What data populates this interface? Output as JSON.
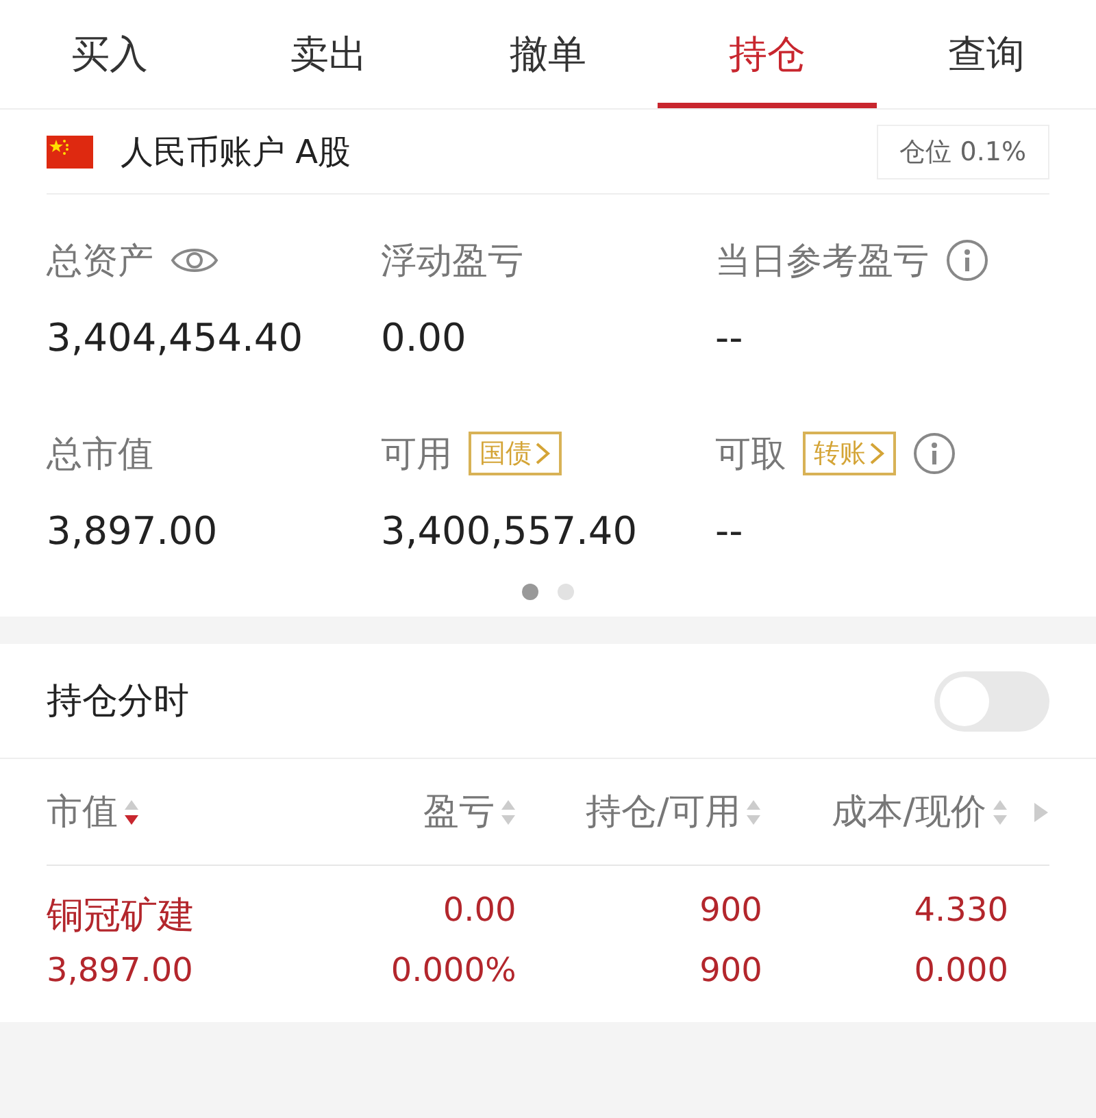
{
  "tabs": [
    {
      "label": "买入",
      "selected": false
    },
    {
      "label": "卖出",
      "selected": false
    },
    {
      "label": "撤单",
      "selected": false
    },
    {
      "label": "持仓",
      "selected": true
    },
    {
      "label": "查询",
      "selected": false
    }
  ],
  "account": {
    "name": "人民币账户 A股",
    "position": "仓位 0.1%"
  },
  "stats": [
    {
      "label": "总资产",
      "value": "3,404,454.40",
      "kind": "hidable"
    },
    {
      "label": "浮动盈亏",
      "value": "0.00",
      "kind": "plain"
    },
    {
      "label": "当日参考盈亏",
      "value": "--",
      "kind": "info"
    },
    {
      "label": "总市值",
      "value": "3,897.00",
      "kind": "plain"
    },
    {
      "label": "可用",
      "value": "3,400,557.40",
      "kind": "plain",
      "tag": "国债"
    },
    {
      "label": "可取",
      "value": "--",
      "kind": "info",
      "tag": "转账"
    }
  ],
  "pager": [
    {
      "selected": true
    },
    {
      "selected": false
    }
  ],
  "timeshare": {
    "label": "持仓分时",
    "on": false
  },
  "table": {
    "columns": [
      {
        "label": "市值",
        "sorted": true
      },
      {
        "label": "盈亏",
        "sorted": false
      },
      {
        "label": "持仓/可用",
        "sorted": false
      },
      {
        "label": "成本/现价",
        "sorted": false
      }
    ],
    "rows": [
      {
        "name": "铜冠矿建",
        "market_value": "3,897.00",
        "pnl": "0.00",
        "pnl_pct": "0.000%",
        "holding": "900",
        "available": "900",
        "cost": "4.330",
        "price": "0.000"
      }
    ]
  }
}
